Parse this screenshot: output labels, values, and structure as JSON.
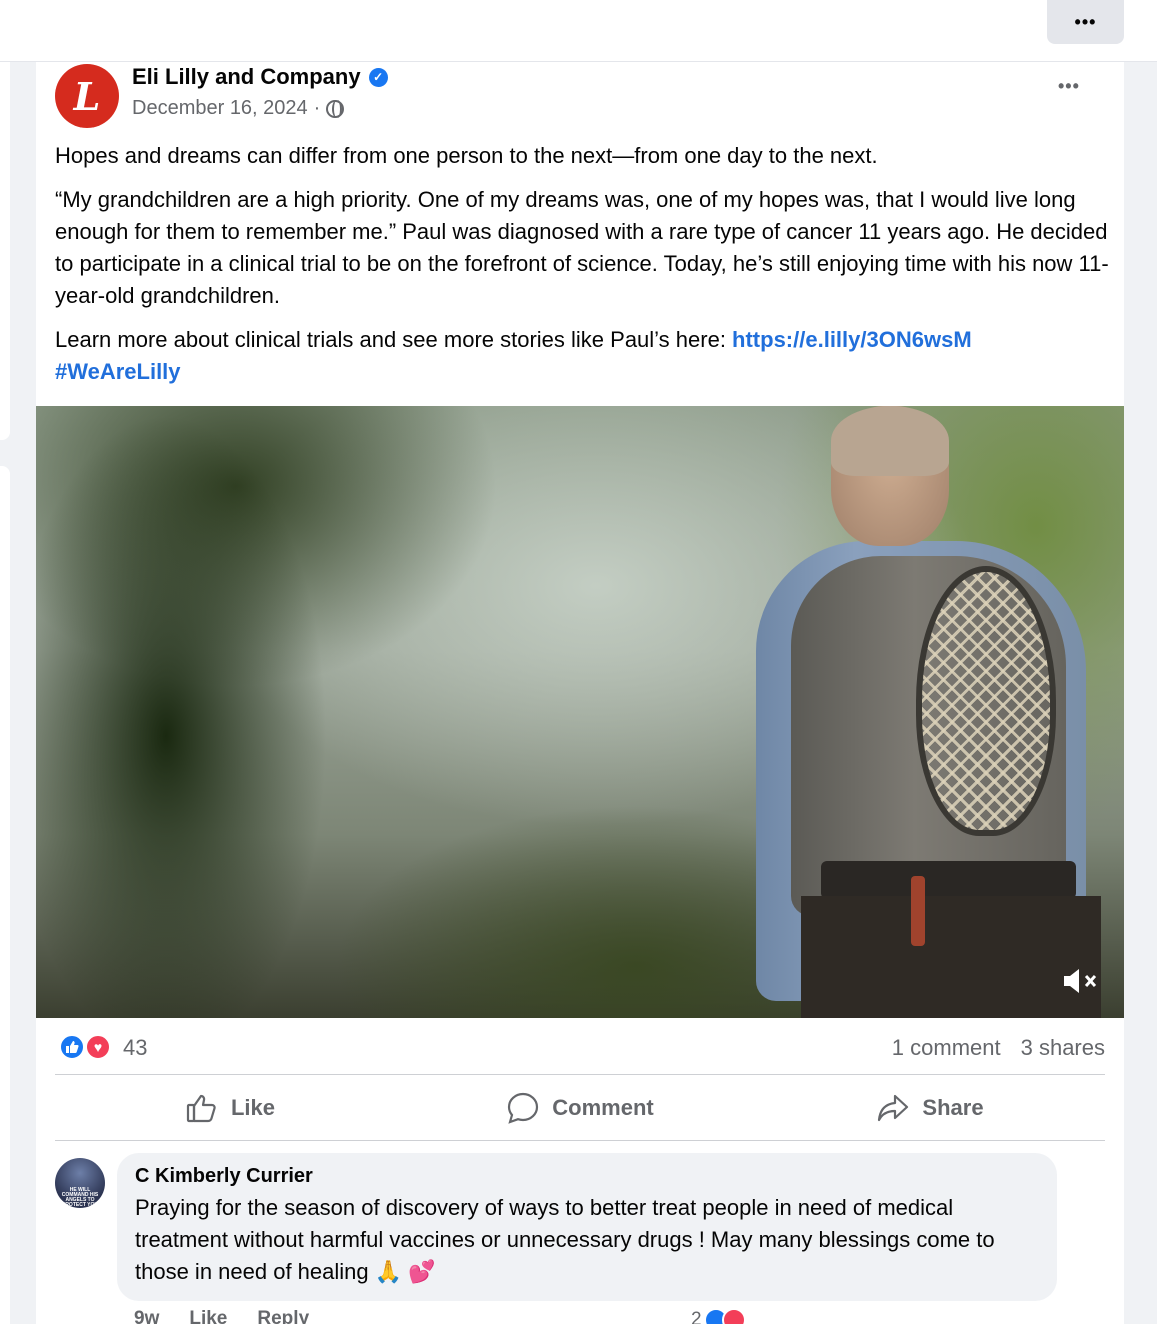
{
  "topbar": {
    "more_label": "•••"
  },
  "post": {
    "author": "Eli Lilly and Company",
    "avatar_letter": "L",
    "date": "December 16, 2024",
    "separator": "·",
    "more_label": "•••",
    "paragraph1": "Hopes and dreams can differ from one person to the next—from one day to the next.",
    "paragraph2": "“My grandchildren are a high priority. One of my dreams was, one of my hopes was, that I would live long enough for them to remember me.” Paul was diagnosed with a rare type of cancer 11 years ago. He decided to participate in a clinical trial to be on the forefront of science. Today, he’s still enjoying time with his now 11-year-old grandchildren.",
    "paragraph3_prefix": "Learn more about clinical trials and see more stories like Paul’s here: ",
    "link": "https://e.lilly/3ON6wsM",
    "hashtag": "#WeAreLilly",
    "video": {
      "muted": true
    }
  },
  "stats": {
    "reaction_count": "43",
    "comments": "1 comment",
    "shares": "3 shares"
  },
  "actions": {
    "like": "Like",
    "comment": "Comment",
    "share": "Share"
  },
  "comment": {
    "name": "C Kimberly Currier",
    "avatar_text": "HE WILL COMMAND HIS ANGELS TO PROTECT YOU",
    "text": "Praying for the season of discovery of ways to better treat people in need of medical treatment without harmful vaccines or unnecessary drugs ! May many blessings come to those in need of healing 🙏 💕",
    "age": "9w",
    "like": "Like",
    "reply": "Reply",
    "reaction_count": "2"
  },
  "colors": {
    "brand_red": "#d52b1e",
    "link_blue": "#216fdb",
    "like_blue": "#1877f2",
    "love_red": "#f33e58"
  }
}
